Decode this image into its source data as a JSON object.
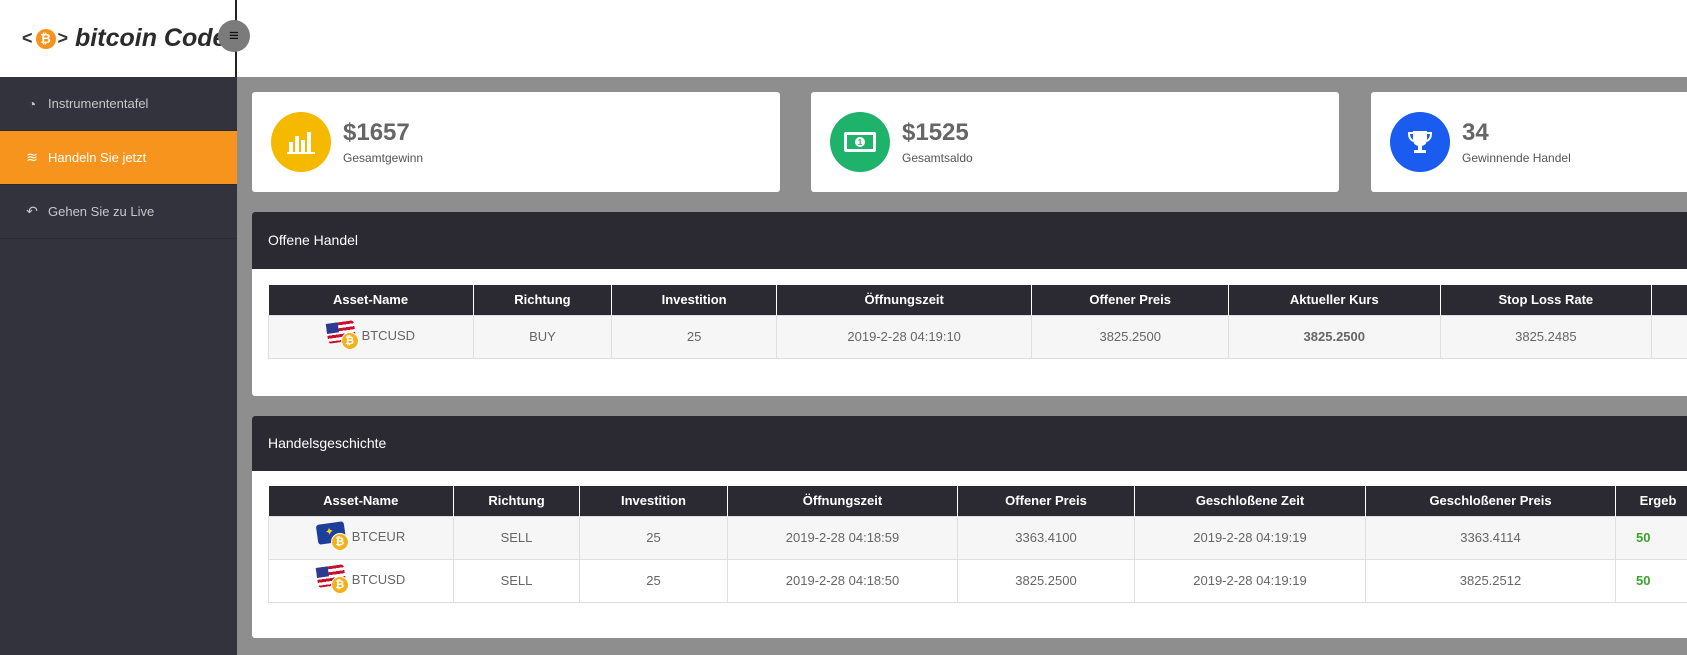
{
  "brand": {
    "code_glyph_left": "<",
    "coin_glyph": "₿",
    "code_glyph_right": ">",
    "name": "bitcoin Code"
  },
  "header": {
    "menu_icon": "≡"
  },
  "sidebar": {
    "items": [
      {
        "label": "Instrumententafel",
        "icon": "dashboard-icon",
        "glyph": "◔",
        "active": false
      },
      {
        "label": "Handeln Sie jetzt",
        "icon": "wifi-icon",
        "glyph": "≋",
        "active": true
      },
      {
        "label": "Gehen Sie zu Live",
        "icon": "reply-icon",
        "glyph": "↶",
        "active": false
      }
    ]
  },
  "stats": [
    {
      "value": "$1657",
      "label": "Gesamtgewinn",
      "icon": "bar-chart-icon",
      "color": "#f5b900"
    },
    {
      "value": "$1525",
      "label": "Gesamtsaldo",
      "icon": "money-icon",
      "color": "#1fb26b"
    },
    {
      "value": "34",
      "label": "Gewinnende Handel",
      "icon": "trophy-icon",
      "color": "#1a5cf0"
    }
  ],
  "open_trades": {
    "title": "Offene Handel",
    "columns": [
      "Asset-Name",
      "Richtung",
      "Investition",
      "Öffnungszeit",
      "Offener Preis",
      "Aktueller Kurs",
      "Stop Loss Rate",
      ""
    ],
    "rows": [
      {
        "asset": "BTCUSD",
        "flag": "us",
        "direction": "BUY",
        "investment": "25",
        "open_time": "2019-2-28 04:19:10",
        "open_price": "3825.2500",
        "current_rate": "3825.2500",
        "stop_loss": "3825.2485",
        "extra": ""
      }
    ]
  },
  "history": {
    "title": "Handelsgeschichte",
    "columns": [
      "Asset-Name",
      "Richtung",
      "Investition",
      "Öffnungszeit",
      "Offener Preis",
      "Geschloßene Zeit",
      "Geschloßener Preis",
      "Ergeb"
    ],
    "rows": [
      {
        "asset": "BTCEUR",
        "flag": "eu",
        "direction": "SELL",
        "investment": "25",
        "open_time": "2019-2-28 04:18:59",
        "open_price": "3363.4100",
        "close_time": "2019-2-28 04:19:19",
        "close_price": "3363.4114",
        "result": "50"
      },
      {
        "asset": "BTCUSD",
        "flag": "us",
        "direction": "SELL",
        "investment": "25",
        "open_time": "2019-2-28 04:18:50",
        "open_price": "3825.2500",
        "close_time": "2019-2-28 04:19:19",
        "close_price": "3825.2512",
        "result": "50"
      }
    ]
  }
}
